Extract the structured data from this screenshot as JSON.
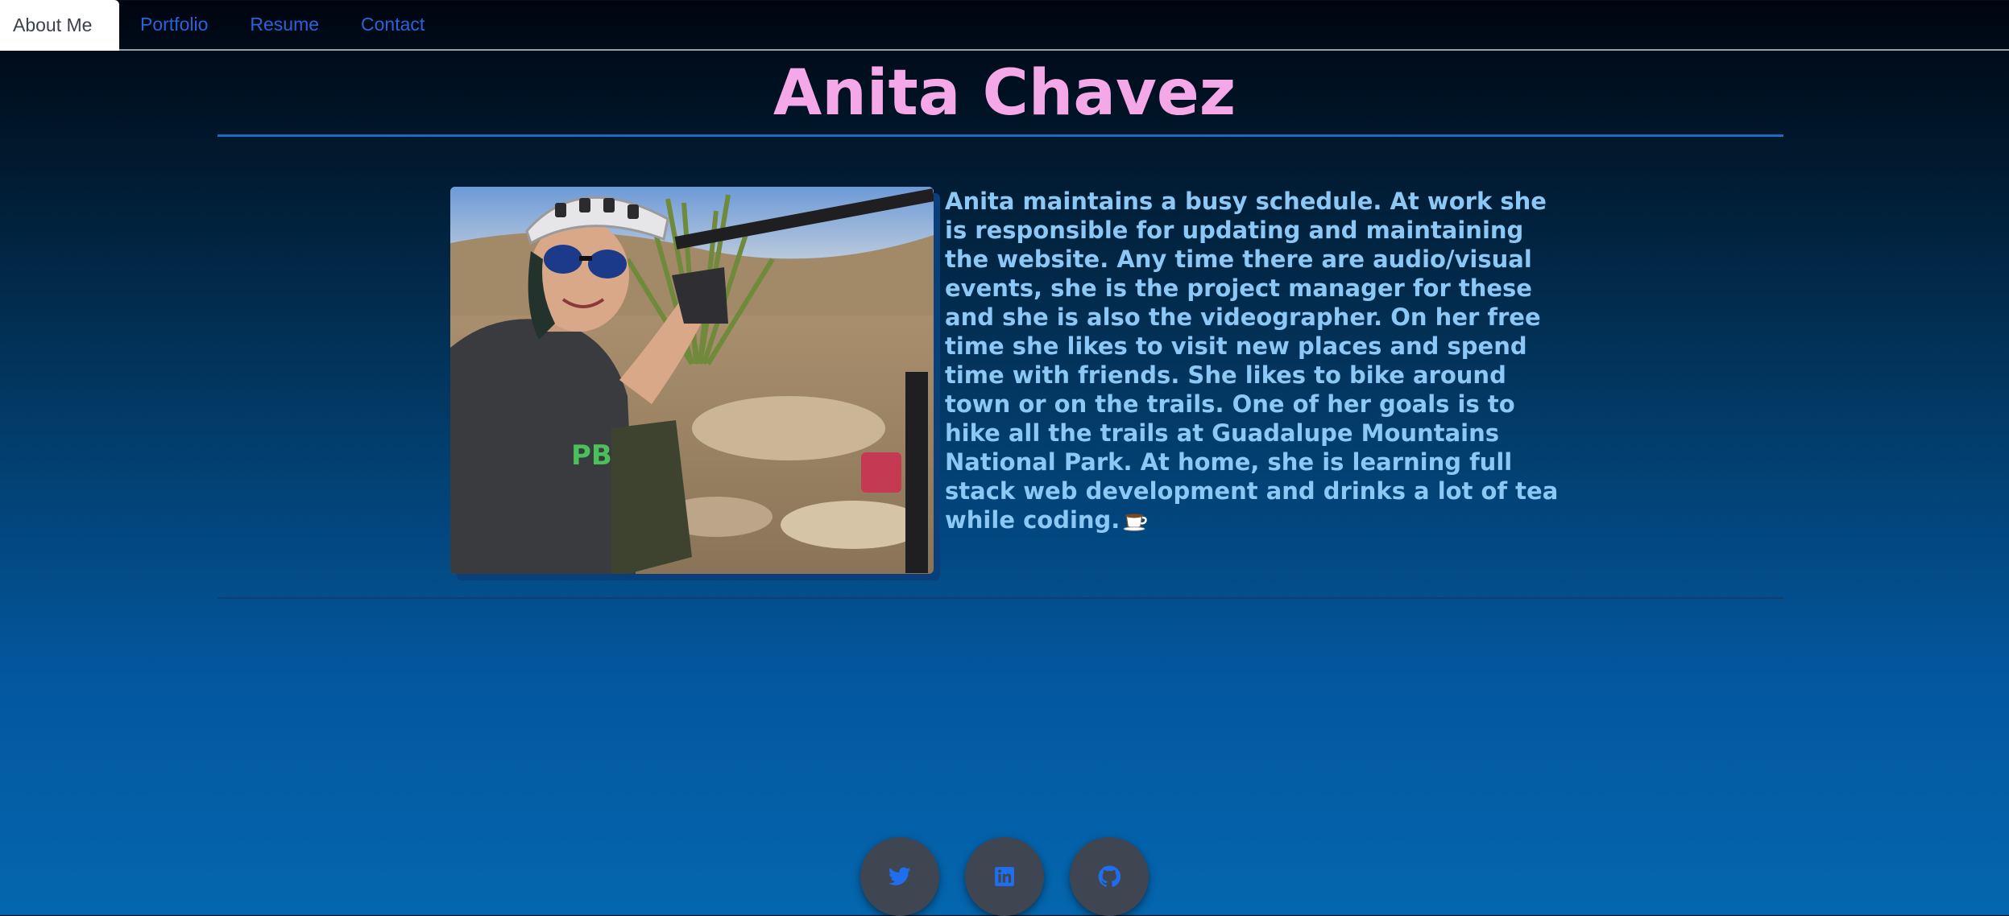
{
  "nav": {
    "tabs": [
      {
        "label": "About Me",
        "active": true
      },
      {
        "label": "Portfolio"
      },
      {
        "label": "Resume"
      },
      {
        "label": "Contact"
      }
    ]
  },
  "header": {
    "title": "Anita Chavez"
  },
  "about": {
    "bio": "Anita maintains a busy schedule. At work she is responsible for updating and maintaining the website. Any time there are audio/visual events, she is the project manager for these and she is also the videographer. On her free time she likes to visit new places and spend time with friends. She likes to bike around town or on the trails. One of her goals is to hike all the trails at Guadalupe Mountains National Park. At home, she is learning full stack web development and drinks a lot of tea while coding."
  },
  "social": [
    {
      "icon": "twitter-icon"
    },
    {
      "icon": "linkedin-icon"
    },
    {
      "icon": "github-icon"
    }
  ],
  "colors": {
    "title": "#f5a8e8",
    "bio_text": "#8cc8f5",
    "nav_link": "#2a63d8",
    "social_icon": "#1e6ff0"
  }
}
